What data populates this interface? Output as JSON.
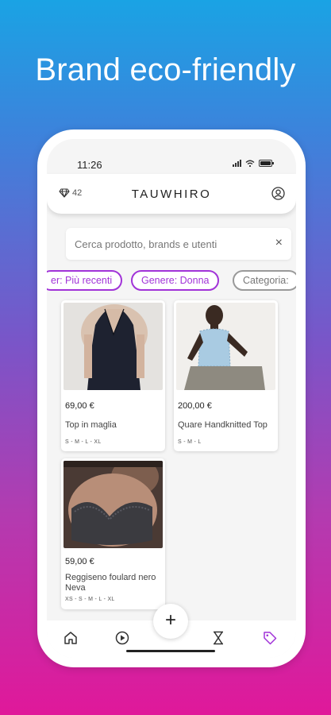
{
  "headline": "Brand eco-friendly",
  "status_bar": {
    "time": "11:26"
  },
  "header": {
    "gems_count": "42",
    "logo": "TAUWHIRO"
  },
  "search": {
    "placeholder": "Cerca prodotto, brands e utenti",
    "clear_icon": "×"
  },
  "filters": [
    {
      "label": "er:  Più recenti",
      "active": true
    },
    {
      "label": "Genere:  Donna",
      "active": true
    },
    {
      "label": "Categoria:",
      "active": false
    }
  ],
  "products": [
    {
      "price": "69,00 €",
      "title": "Top in maglia",
      "sizes": "S - M - L - XL"
    },
    {
      "price": "200,00 €",
      "title": "Quare Handknitted Top",
      "sizes": "S - M - L"
    },
    {
      "price": "59,00 €",
      "title": "Reggiseno foulard nero Neva",
      "sizes": "XS - S - M - L - XL"
    }
  ],
  "fab": {
    "label": "+"
  },
  "nav": {
    "icons": [
      "home-icon",
      "play-icon",
      "hourglass-icon",
      "tag-icon"
    ],
    "active": "tag-icon",
    "accent": "#a133d8"
  }
}
